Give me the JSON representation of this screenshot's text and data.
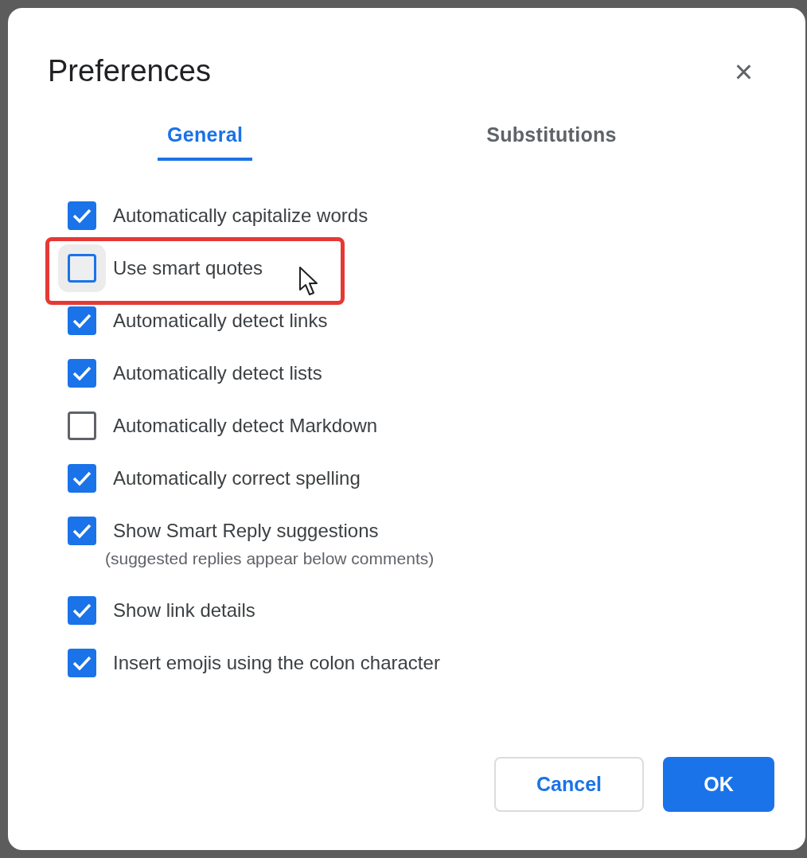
{
  "dialog": {
    "title": "Preferences",
    "close": "×"
  },
  "tabs": [
    {
      "label": "General",
      "selected": true
    },
    {
      "label": "Substitutions",
      "selected": false
    }
  ],
  "options": [
    {
      "label": "Automatically capitalize words",
      "checked": true
    },
    {
      "label": "Use smart quotes",
      "checked": false,
      "hovered": true,
      "highlighted": true
    },
    {
      "label": "Automatically detect links",
      "checked": true
    },
    {
      "label": "Automatically detect lists",
      "checked": true
    },
    {
      "label": "Automatically detect Markdown",
      "checked": false
    },
    {
      "label": "Automatically correct spelling",
      "checked": true
    },
    {
      "label": "Show Smart Reply suggestions",
      "checked": true,
      "note": "(suggested replies appear below comments)"
    },
    {
      "label": "Show link details",
      "checked": true
    },
    {
      "label": "Insert emojis using the colon character",
      "checked": true
    }
  ],
  "buttons": [
    {
      "label": "Cancel",
      "kind": "secondary"
    },
    {
      "label": "OK",
      "kind": "primary"
    }
  ]
}
